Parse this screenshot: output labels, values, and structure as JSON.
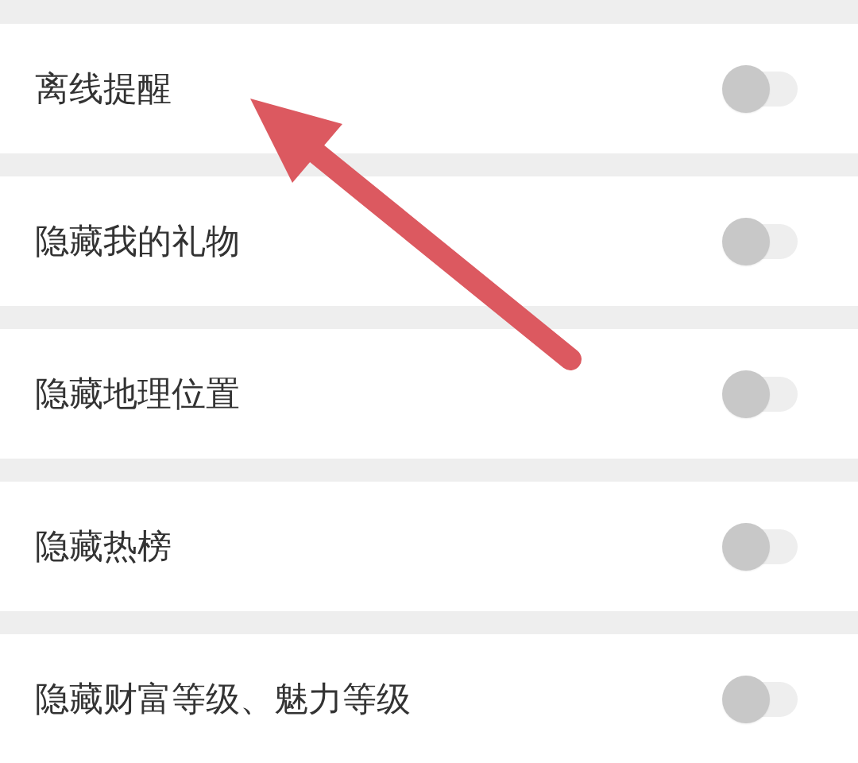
{
  "settings": [
    {
      "label": "离线提醒",
      "on": false
    },
    {
      "label": "隐藏我的礼物",
      "on": false
    },
    {
      "label": "隐藏地理位置",
      "on": false
    },
    {
      "label": "隐藏热榜",
      "on": false
    },
    {
      "label": "隐藏财富等级、魅力等级",
      "on": false
    }
  ],
  "annotation": {
    "kind": "arrow"
  }
}
